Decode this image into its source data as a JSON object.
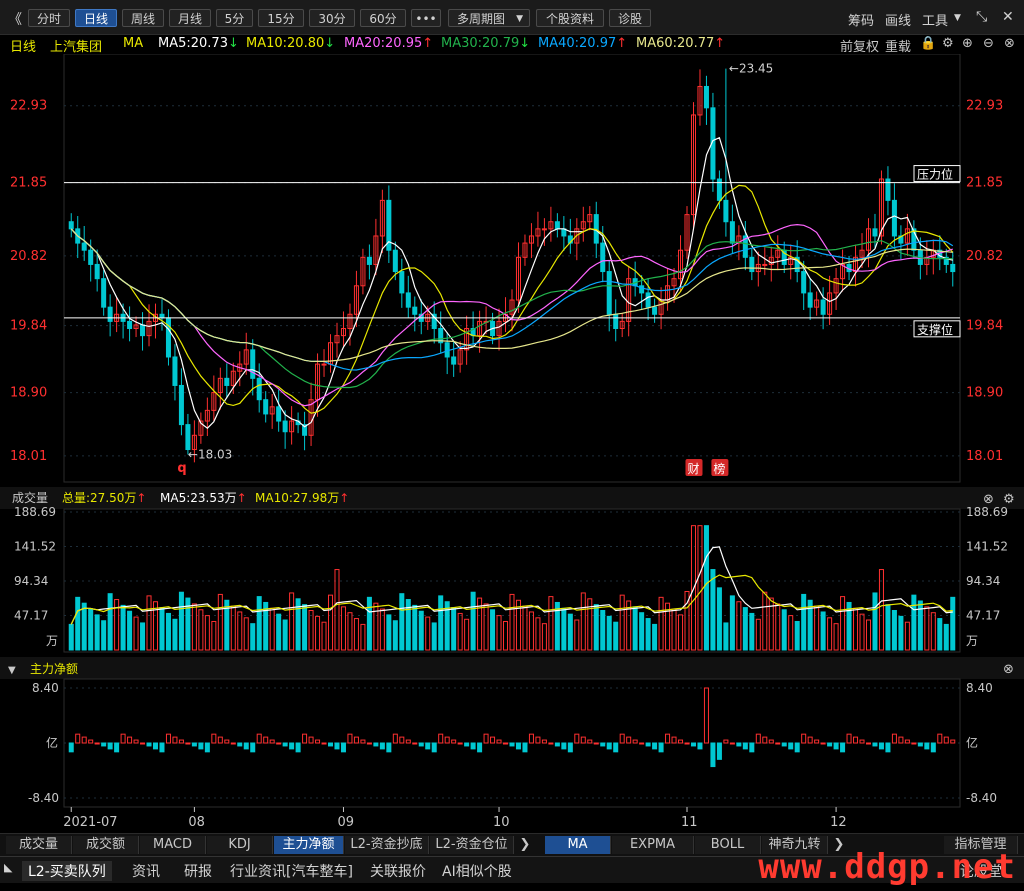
{
  "toolbar": {
    "back": "《",
    "periods": [
      "分时",
      "日线",
      "周线",
      "月线",
      "5分",
      "15分",
      "30分",
      "60分",
      "•••"
    ],
    "active": "日线",
    "multi": "多周期图",
    "profile": "个股资料",
    "diag": "诊股",
    "right": [
      "筹码",
      "画线",
      "工具"
    ],
    "drop_icon": "▼",
    "expand_icon": "⤡",
    "close_icon": "✕"
  },
  "ma_bar": {
    "period": "日线",
    "stock": "上汽集团",
    "ma": "MA",
    "ma5": "MA5:20.73",
    "ma10": "MA10:20.80",
    "ma20": "MA20:20.95",
    "ma30": "MA30:20.79",
    "ma40": "MA40:20.97",
    "ma60": "MA60:20.77",
    "up": "↑",
    "down": "↓",
    "adj": "前复权",
    "reload": "重载"
  },
  "colors": {
    "up": "#ff3030",
    "down": "#00c8d2",
    "ma5": "#ffffff",
    "ma10": "#e8e800",
    "ma20": "#ff66ff",
    "ma30": "#22b24c",
    "ma40": "#0aa8ff",
    "ma60": "#e6e68c",
    "price_label": "#ff3030",
    "bg": "#000000",
    "grid": "#1e2e3a"
  },
  "chart_data": {
    "type": "candlestick",
    "ylim": [
      17.7,
      23.6
    ],
    "price_ticks": [
      "22.93",
      "21.85",
      "20.82",
      "19.84",
      "18.90",
      "18.01"
    ],
    "price_tick_values": [
      22.93,
      21.85,
      20.82,
      19.84,
      18.9,
      18.01
    ],
    "resistance": {
      "label": "压力位",
      "value": 21.85
    },
    "support": {
      "label": "支撑位",
      "value": 19.95
    },
    "high_label": "←23.45",
    "high_value": 23.45,
    "high_index": 101,
    "low_label": "←18.03",
    "low_value": 18.03,
    "low_index": 18,
    "marker_q": "q",
    "q_index": 17,
    "event_tags": [
      {
        "text": "财",
        "index": 96
      },
      {
        "text": "榜",
        "index": 100
      }
    ],
    "x_labels": [
      {
        "label": "2021-07",
        "index": 0
      },
      {
        "label": "08",
        "index": 19
      },
      {
        "label": "09",
        "index": 42
      },
      {
        "label": "10",
        "index": 66
      },
      {
        "label": "11",
        "index": 95
      },
      {
        "label": "12",
        "index": 118
      }
    ],
    "volume": {
      "title": "成交量",
      "total": "总量:27.50万",
      "ma5": "MA5:23.53万",
      "ma10": "MA10:27.98万",
      "ticks": [
        "188.69",
        "141.52",
        "94.34",
        "47.17"
      ],
      "tick_values": [
        188.69,
        141.52,
        94.34,
        47.17
      ],
      "unit": "万",
      "max": 188.69
    },
    "net": {
      "title": "主力净额",
      "ticks": [
        "8.40",
        "亿",
        "-8.40"
      ],
      "max": 8.4
    },
    "ohlc": [],
    "volumes": [],
    "net_flow": []
  },
  "tabs": [
    "成交量",
    "成交额",
    "MACD",
    "KDJ",
    "主力净额",
    "L2-资金抄底",
    "L2-资金仓位"
  ],
  "tabs_active": "主力净额",
  "tabs2": [
    "MA",
    "EXPMA",
    "BOLL",
    "神奇九转"
  ],
  "tabs2_active": "MA",
  "tabs_more": "指标管理",
  "arrow": "❯",
  "bottom_tabs": [
    "L2-买卖队列",
    "资讯",
    "研报",
    "行业资讯[汽车整车]",
    "关联报价",
    "AI相似个股"
  ],
  "bottom_active": "L2-买卖队列",
  "bottom_right": "论股堂",
  "watermark": "www.ddgp.net"
}
